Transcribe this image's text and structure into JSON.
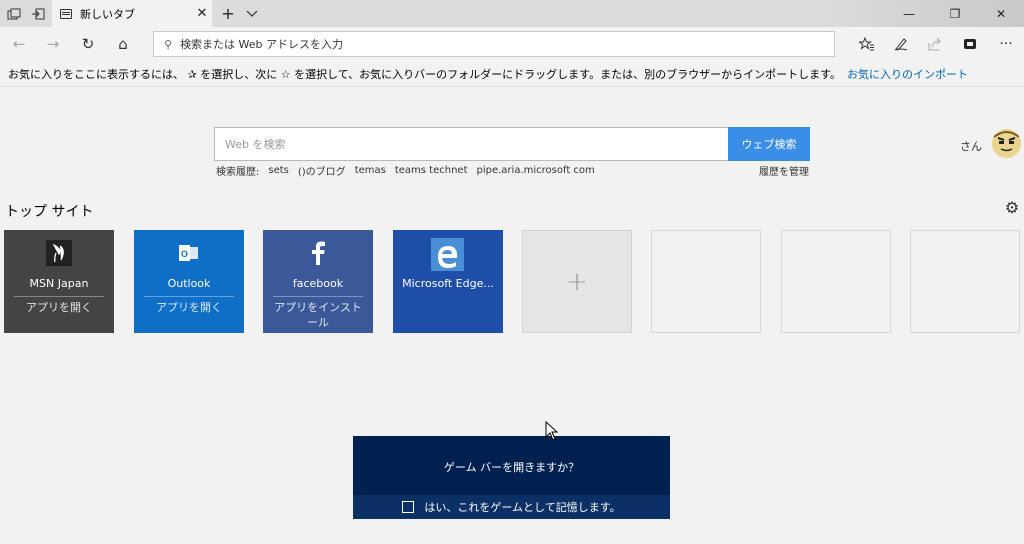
{
  "tab": {
    "title": "新しいタブ",
    "close": "✕"
  },
  "titlebar": {
    "new_tab": "+",
    "tab_menu": "⌄",
    "minimize": "—",
    "restore": "❐",
    "close": "✕"
  },
  "nav": {
    "back": "←",
    "forward": "→",
    "refresh": "↻",
    "home": "⌂",
    "more": "···"
  },
  "address": {
    "placeholder": "検索または Web アドレスを入力"
  },
  "favorites_bar": {
    "message": "お気に入りをここに表示するには、 ✰ を選択し、次に ☆ を選択して、お気に入りバーのフォルダーにドラッグします。または、別のブラウザーからインポートします。",
    "import_link": "お気に入りのインポート"
  },
  "search": {
    "placeholder": "Web を検索",
    "button": "ウェブ検索",
    "history_label": "検索履歴:",
    "history_items": [
      "sets",
      "()のブログ",
      "temas",
      "teams technet",
      "pipe.aria.microsoft com"
    ],
    "manage_history": "履歴を管理"
  },
  "user": {
    "name": "さん"
  },
  "top_sites": {
    "title": "トップ サイト",
    "tiles": [
      {
        "name": "MSN Japan",
        "action": "アプリを開く",
        "color": "#444444"
      },
      {
        "name": "Outlook",
        "action": "アプリを開く",
        "color": "#0f6fc6"
      },
      {
        "name": "facebook",
        "action": "アプリをインストール",
        "color": "#3b5998"
      },
      {
        "name": "Microsoft Edge...",
        "action": "",
        "color": "#1e4ea8"
      }
    ],
    "add": "+"
  },
  "gamebar": {
    "question": "ゲーム バーを開きますか？",
    "checkbox_label": "はい、これをゲームとして記憶します。"
  }
}
